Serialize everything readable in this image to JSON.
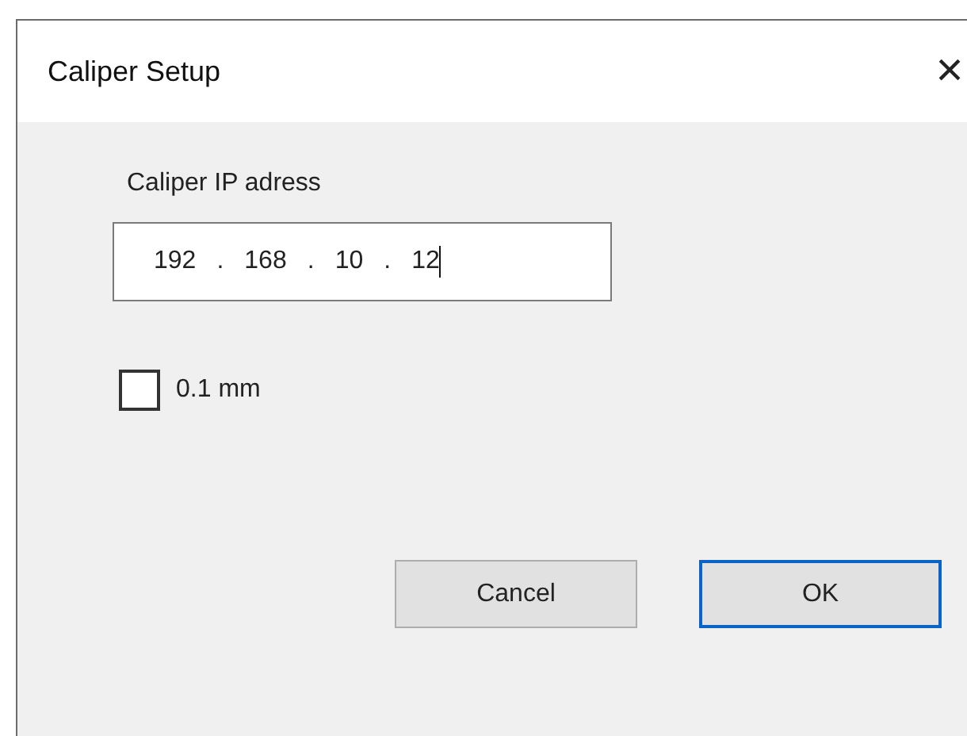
{
  "window": {
    "title": "Caliper Setup",
    "close": "×"
  },
  "ip_field": {
    "label": "Caliper IP adress",
    "octets": [
      "192",
      "168",
      "10",
      "12"
    ],
    "separators": [
      ".",
      ".",
      "."
    ],
    "focused": true
  },
  "checkbox": {
    "label": "0.1 mm",
    "checked": false
  },
  "buttons": [
    {
      "label": "Cancel",
      "default": false
    },
    {
      "label": "OK",
      "default": true
    }
  ]
}
